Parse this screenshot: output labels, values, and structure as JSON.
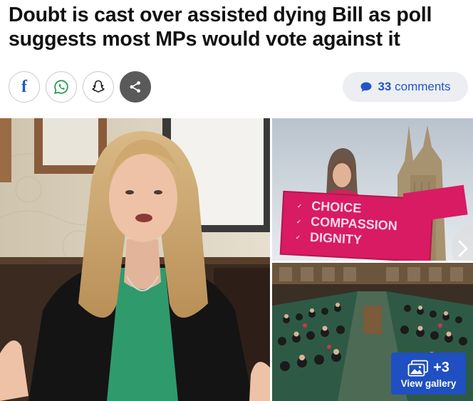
{
  "article": {
    "headline": "Doubt is cast over assisted dying Bill as poll suggests most MPs would vote against it"
  },
  "share": {
    "facebook_icon": "facebook-icon",
    "whatsapp_icon": "whatsapp-icon",
    "snapchat_icon": "snapchat-icon",
    "share_icon": "share-icon",
    "facebook_glyph": "f"
  },
  "comments": {
    "count": "33",
    "label": "comments",
    "icon": "speech-bubble-icon",
    "color": "#1f56c4"
  },
  "gallery": {
    "more_count": "+3",
    "view_label": "View gallery",
    "icon": "gallery-icon",
    "button_color": "#1f4fc1",
    "placard_lines": [
      "CHOICE",
      "COMPASSION",
      "DIGNITY"
    ]
  }
}
